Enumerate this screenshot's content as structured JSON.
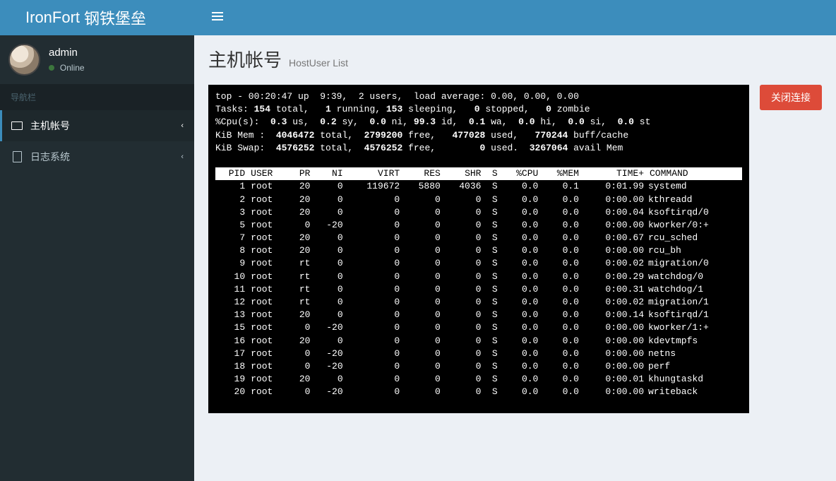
{
  "brand": {
    "name": "IronFort",
    "suffix": "钢铁堡垒"
  },
  "user": {
    "name": "admin",
    "status": "Online"
  },
  "nav": {
    "header": "导航栏",
    "items": [
      {
        "label": "主机帐号",
        "icon": "laptop-icon"
      },
      {
        "label": "日志系统",
        "icon": "file-icon"
      }
    ]
  },
  "page": {
    "title": "主机帐号",
    "subtitle": "HostUser List"
  },
  "close_button": "关闭连接",
  "top": {
    "summary": "top - 00:20:47 up  9:39,  2 users,  load average: 0.00, 0.00, 0.00",
    "tasks_label": "Tasks:",
    "tasks": {
      "total": "154",
      "running": "1",
      "sleeping": "153",
      "stopped": "0",
      "zombie": "0"
    },
    "cpu_label": "%Cpu(s):",
    "cpu": {
      "us": "0.3",
      "sy": "0.2",
      "ni": "0.0",
      "id": "99.3",
      "wa": "0.1",
      "hi": "0.0",
      "si": "0.0",
      "st": "0.0"
    },
    "mem_label": "KiB Mem :",
    "mem": {
      "total": "4046472",
      "free": "2799200",
      "used": "477028",
      "buff": "770244"
    },
    "swap_label": "KiB Swap:",
    "swap": {
      "total": "4576252",
      "free": "4576252",
      "used": "0",
      "avail": "3267064"
    },
    "columns": [
      "PID",
      "USER",
      "PR",
      "NI",
      "VIRT",
      "RES",
      "SHR",
      "S",
      "%CPU",
      "%MEM",
      "TIME+",
      "COMMAND"
    ],
    "rows": [
      {
        "pid": "1",
        "user": "root",
        "pr": "20",
        "ni": "0",
        "virt": "119672",
        "res": "5880",
        "shr": "4036",
        "s": "S",
        "cpu": "0.0",
        "mem": "0.1",
        "time": "0:01.99",
        "cmd": "systemd"
      },
      {
        "pid": "2",
        "user": "root",
        "pr": "20",
        "ni": "0",
        "virt": "0",
        "res": "0",
        "shr": "0",
        "s": "S",
        "cpu": "0.0",
        "mem": "0.0",
        "time": "0:00.00",
        "cmd": "kthreadd"
      },
      {
        "pid": "3",
        "user": "root",
        "pr": "20",
        "ni": "0",
        "virt": "0",
        "res": "0",
        "shr": "0",
        "s": "S",
        "cpu": "0.0",
        "mem": "0.0",
        "time": "0:00.04",
        "cmd": "ksoftirqd/0"
      },
      {
        "pid": "5",
        "user": "root",
        "pr": "0",
        "ni": "-20",
        "virt": "0",
        "res": "0",
        "shr": "0",
        "s": "S",
        "cpu": "0.0",
        "mem": "0.0",
        "time": "0:00.00",
        "cmd": "kworker/0:+"
      },
      {
        "pid": "7",
        "user": "root",
        "pr": "20",
        "ni": "0",
        "virt": "0",
        "res": "0",
        "shr": "0",
        "s": "S",
        "cpu": "0.0",
        "mem": "0.0",
        "time": "0:00.67",
        "cmd": "rcu_sched"
      },
      {
        "pid": "8",
        "user": "root",
        "pr": "20",
        "ni": "0",
        "virt": "0",
        "res": "0",
        "shr": "0",
        "s": "S",
        "cpu": "0.0",
        "mem": "0.0",
        "time": "0:00.00",
        "cmd": "rcu_bh"
      },
      {
        "pid": "9",
        "user": "root",
        "pr": "rt",
        "ni": "0",
        "virt": "0",
        "res": "0",
        "shr": "0",
        "s": "S",
        "cpu": "0.0",
        "mem": "0.0",
        "time": "0:00.02",
        "cmd": "migration/0"
      },
      {
        "pid": "10",
        "user": "root",
        "pr": "rt",
        "ni": "0",
        "virt": "0",
        "res": "0",
        "shr": "0",
        "s": "S",
        "cpu": "0.0",
        "mem": "0.0",
        "time": "0:00.29",
        "cmd": "watchdog/0"
      },
      {
        "pid": "11",
        "user": "root",
        "pr": "rt",
        "ni": "0",
        "virt": "0",
        "res": "0",
        "shr": "0",
        "s": "S",
        "cpu": "0.0",
        "mem": "0.0",
        "time": "0:00.31",
        "cmd": "watchdog/1"
      },
      {
        "pid": "12",
        "user": "root",
        "pr": "rt",
        "ni": "0",
        "virt": "0",
        "res": "0",
        "shr": "0",
        "s": "S",
        "cpu": "0.0",
        "mem": "0.0",
        "time": "0:00.02",
        "cmd": "migration/1"
      },
      {
        "pid": "13",
        "user": "root",
        "pr": "20",
        "ni": "0",
        "virt": "0",
        "res": "0",
        "shr": "0",
        "s": "S",
        "cpu": "0.0",
        "mem": "0.0",
        "time": "0:00.14",
        "cmd": "ksoftirqd/1"
      },
      {
        "pid": "15",
        "user": "root",
        "pr": "0",
        "ni": "-20",
        "virt": "0",
        "res": "0",
        "shr": "0",
        "s": "S",
        "cpu": "0.0",
        "mem": "0.0",
        "time": "0:00.00",
        "cmd": "kworker/1:+"
      },
      {
        "pid": "16",
        "user": "root",
        "pr": "20",
        "ni": "0",
        "virt": "0",
        "res": "0",
        "shr": "0",
        "s": "S",
        "cpu": "0.0",
        "mem": "0.0",
        "time": "0:00.00",
        "cmd": "kdevtmpfs"
      },
      {
        "pid": "17",
        "user": "root",
        "pr": "0",
        "ni": "-20",
        "virt": "0",
        "res": "0",
        "shr": "0",
        "s": "S",
        "cpu": "0.0",
        "mem": "0.0",
        "time": "0:00.00",
        "cmd": "netns"
      },
      {
        "pid": "18",
        "user": "root",
        "pr": "0",
        "ni": "-20",
        "virt": "0",
        "res": "0",
        "shr": "0",
        "s": "S",
        "cpu": "0.0",
        "mem": "0.0",
        "time": "0:00.00",
        "cmd": "perf"
      },
      {
        "pid": "19",
        "user": "root",
        "pr": "20",
        "ni": "0",
        "virt": "0",
        "res": "0",
        "shr": "0",
        "s": "S",
        "cpu": "0.0",
        "mem": "0.0",
        "time": "0:00.01",
        "cmd": "khungtaskd"
      },
      {
        "pid": "20",
        "user": "root",
        "pr": "0",
        "ni": "-20",
        "virt": "0",
        "res": "0",
        "shr": "0",
        "s": "S",
        "cpu": "0.0",
        "mem": "0.0",
        "time": "0:00.00",
        "cmd": "writeback"
      }
    ]
  }
}
